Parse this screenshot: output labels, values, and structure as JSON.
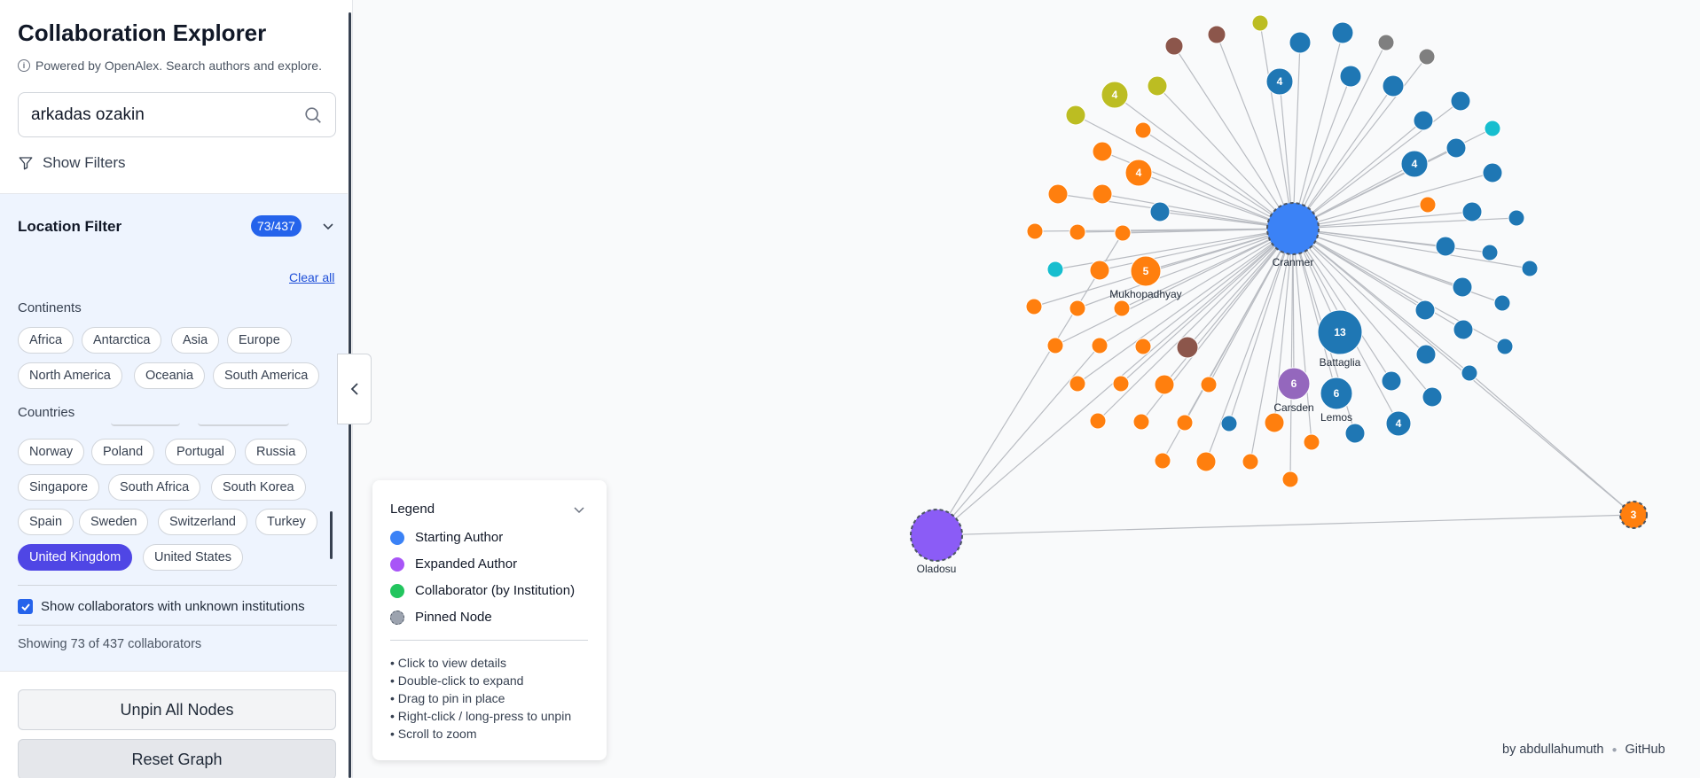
{
  "app": {
    "title": "Collaboration Explorer",
    "subtitle": "Powered by OpenAlex. Search authors and explore."
  },
  "search": {
    "value": "arkadas ozakin",
    "placeholder": ""
  },
  "filters_toggle": "Show Filters",
  "location_filter": {
    "title": "Location Filter",
    "badge": "73/437",
    "clear_all": "Clear all",
    "continents_label": "Continents",
    "continents": [
      "Africa",
      "Antarctica",
      "Asia",
      "Europe",
      "North America",
      "Oceania",
      "South America"
    ],
    "countries_label": "Countries",
    "countries": [
      "Norway",
      "Poland",
      "Portugal",
      "Russia",
      "Singapore",
      "South Africa",
      "South Korea",
      "Spain",
      "Sweden",
      "Switzerland",
      "Turkey",
      "United Kingdom",
      "United States"
    ],
    "selected_country": "United Kingdom",
    "unknown_label": "Show collaborators with unknown institutions",
    "unknown_checked": true,
    "showing": "Showing 73 of 437 collaborators"
  },
  "buttons": {
    "unpin": "Unpin All Nodes",
    "reset": "Reset Graph"
  },
  "legend": {
    "title": "Legend",
    "items": [
      {
        "label": "Starting Author",
        "color": "#3b82f6"
      },
      {
        "label": "Expanded Author",
        "color": "#a855f7"
      },
      {
        "label": "Collaborator (by Institution)",
        "color": "#22c55e"
      },
      {
        "label": "Pinned Node",
        "color": "#9ca3af"
      }
    ],
    "hints": [
      "• Click to view details",
      "• Double-click to expand",
      "• Drag to pin in place",
      "• Right-click / long-press to unpin",
      "• Scroll to zoom"
    ]
  },
  "footer": {
    "author": "by abdullahumuth",
    "link": "GitHub"
  },
  "graph": {
    "colors": {
      "start": "#3b82f6",
      "expanded": "#8b5cf6",
      "orange": "#ff7f0e",
      "blue": "#1f77b4",
      "olive": "#bcbd22",
      "brown": "#8c564b",
      "gray": "#7f7f7f",
      "cyan": "#17becf",
      "purple": "#9467bd"
    },
    "labels": {
      "cranmer": "Cranmer",
      "mukhopadhyay": "Mukhopadhyay",
      "battaglia": "Battaglia",
      "carsden": "Carsden",
      "lemos": "Lemos",
      "oladosu": "Oladosu"
    },
    "counts": {
      "n4a": "4",
      "n4b": "4",
      "n4c": "4",
      "n4d": "4",
      "n4e": "4",
      "n5": "5",
      "n13": "13",
      "n6a": "6",
      "n6b": "6",
      "n3": "3"
    }
  }
}
